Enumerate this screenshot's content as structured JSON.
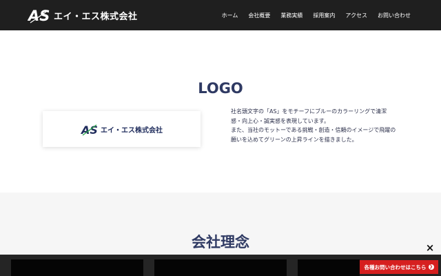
{
  "header": {
    "brand_mark": "AS",
    "brand_name": "エイ・エス株式会社",
    "nav": [
      "ホーム",
      "会社概要",
      "業務実績",
      "採用案内",
      "アクセス",
      "お問い合わせ"
    ]
  },
  "logo_section": {
    "title": "LOGO",
    "card_mark": "AS",
    "card_name": "エイ・エス株式会社",
    "description": [
      "社名頭文字の「AS」をモチーフにブルーのカラーリングで清潔感・向上心・誠実感を表現しています。",
      "また、当社のモットーである挑戦・創造・信頼のイメージで飛躍の願いを込めてグリーンの上昇ラインを描きました。"
    ]
  },
  "philosophy": {
    "title": "会社理念"
  },
  "footer_cta": {
    "label": "各種お問い合わせはこちら",
    "close": "×"
  },
  "colors": {
    "header_bg": "#1f1f1f",
    "title": "#2f3a63",
    "brand_blue": "#1f2c5c",
    "brand_green": "#2aa64a",
    "cta_red": "#d61f1f"
  },
  "icons": [
    "as-logo-icon",
    "close-icon",
    "arrow-right-icon"
  ]
}
